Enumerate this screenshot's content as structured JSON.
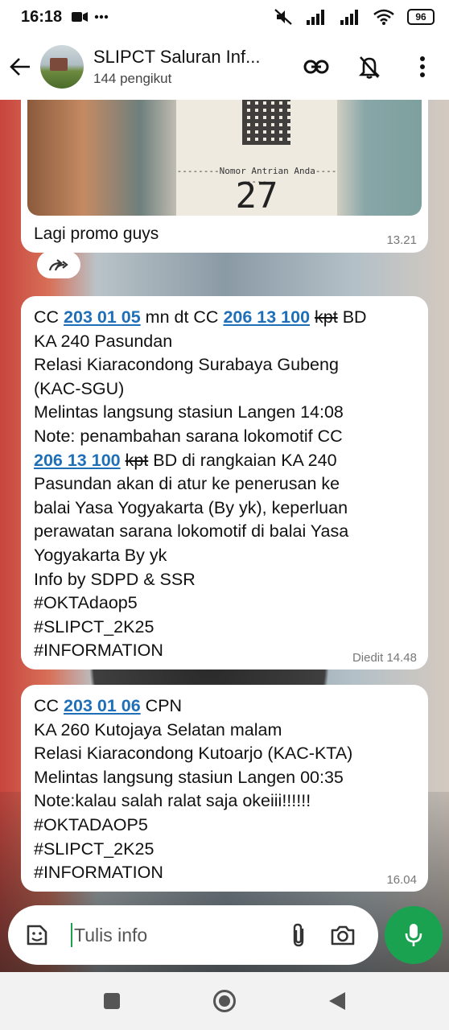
{
  "status_bar": {
    "time": "16:18",
    "battery": "96",
    "icons": [
      "video-camera-icon",
      "more-dots-icon",
      "mute-icon",
      "signal-icon",
      "signal-icon",
      "wifi-icon",
      "battery-icon"
    ]
  },
  "header": {
    "title": "SLIPCT Saluran Inf...",
    "subtitle": "144 pengikut",
    "icons": [
      "back-arrow-icon",
      "link-icon",
      "notifications-off-icon",
      "more-vert-icon"
    ]
  },
  "messages": [
    {
      "type": "photo",
      "photo": {
        "ticket_label": "--------Nomor Antrian Anda--------",
        "ticket_number": "27"
      },
      "caption": "Lagi promo guys",
      "time": "13.21"
    },
    {
      "type": "text",
      "lines": {
        "l1_a": "CC ",
        "l1_link1": "203 01 05",
        "l1_b": " mn dt CC ",
        "l1_link2": "206 13 100",
        "l1_c": " ",
        "l1_strike": "kpt",
        "l1_d": " BD",
        "l2": "KA 240 Pasundan",
        "l3": "Relasi Kiaracondong Surabaya Gubeng",
        "l4": "(KAC-SGU)",
        "l5": "Melintas langsung stasiun Langen 14:08",
        "l6": "Note: penambahan sarana lokomotif CC",
        "l7_link": "206 13 100",
        "l7_a": " ",
        "l7_strike": "kpt",
        "l7_b": " BD di rangkaian KA 240",
        "l8": "Pasundan akan di atur ke penerusan ke",
        "l9": "balai Yasa Yogyakarta (By yk), keperluan",
        "l10": "perawatan sarana lokomotif di balai Yasa",
        "l11": "Yogyakarta By yk",
        "l12": "Info by SDPD & SSR",
        "l13": "#OKTAdaop5",
        "l14": "#SLIPCT_2K25",
        "l15": "#INFORMATION"
      },
      "time": "Diedit  14.48"
    },
    {
      "type": "text",
      "lines": {
        "l1_a": "CC ",
        "l1_link": "203 01 06",
        "l1_b": " CPN",
        "l2": "KA 260 Kutojaya Selatan malam",
        "l3": "Relasi Kiaracondong Kutoarjo (KAC-KTA)",
        "l4": "Melintas langsung stasiun Langen 00:35",
        "l5": "Note:kalau salah ralat saja okeiii!!!!!!",
        "l6": "#OKTADAOP5",
        "l7": "#SLIPCT_2K25",
        "l8": "#INFORMATION"
      },
      "time": "16.04"
    }
  ],
  "input": {
    "placeholder": "Tulis info",
    "icons": [
      "emoji-icon",
      "attach-icon",
      "camera-icon",
      "mic-icon"
    ]
  },
  "nav": {
    "icons": [
      "recents-square-icon",
      "home-circle-icon",
      "back-triangle-icon"
    ]
  },
  "colors": {
    "accent_green": "#1aa251",
    "link_blue": "#1f6fb8",
    "bubble_bg": "#ffffff",
    "timestamp": "#777777"
  }
}
